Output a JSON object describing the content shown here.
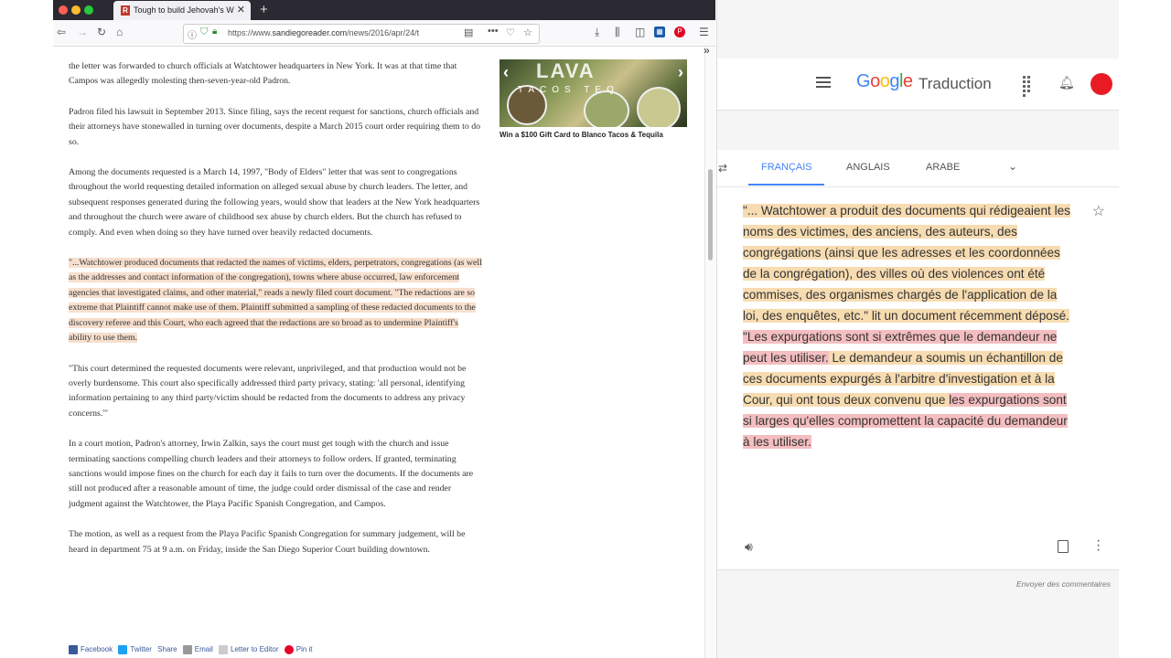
{
  "browser": {
    "tab_title": "Tough to build Jehovah's Witne",
    "tab_favicon": "R",
    "url_prefix": "https://www.",
    "url_domain": "sandiegoreader.com",
    "url_path": "/news/2016/apr/24/t",
    "icons": [
      "back-icon",
      "forward-icon",
      "reload-icon",
      "home-icon",
      "info-icon",
      "shield-icon",
      "lock-icon",
      "reader-icon",
      "more-icon",
      "pocket-icon",
      "bookmark-star-icon",
      "download-icon",
      "library-icon",
      "sidebar-icon",
      "extension-icon",
      "pinterest-icon",
      "menu-icon"
    ]
  },
  "article": {
    "paragraphs": [
      "the letter was forwarded to church officials at Watchtower headquarters in New York. It was at that time that Campos was allegedly molesting then-seven-year-old Padron.",
      "Padron filed his lawsuit in September 2013. Since filing, says the recent request for sanctions, church officials and their attorneys have stonewalled in turning over documents, despite a March 2015 court order requiring them to do so.",
      "Among the documents requested is a March 14, 1997, \"Body of Elders\" letter that was sent to congregations throughout the world requesting detailed information on alleged sexual abuse by church leaders. The letter, and subsequent responses generated during the following years, would show that leaders at the New York headquarters and throughout the church were aware of childhood sex abuse by church elders. But the church has refused to comply. And even when doing so they have turned over heavily redacted documents.",
      "\"...Watchtower produced documents that redacted the names of victims, elders, perpetrators, congregations (as well as the addresses and contact information of the congregation), towns where abuse occurred, law enforcement agencies that investigated claims, and other material,\" reads a newly filed court document. \"The redactions are so extreme that Plaintiff cannot make use of them. Plaintiff submitted a sampling of these redacted documents to the discovery referee and this Court, who each agreed that the redactions are so broad as to undermine Plaintiff's ability to use them.",
      "\"This court determined the requested documents were relevant, unprivileged, and that production would not be overly burdensome. This court also specifically addressed third party privacy, stating: 'all personal, identifying information pertaining to any third party/victim should be redacted from the documents to address any privacy concerns.'\"",
      "In a court motion, Padron's attorney, Irwin Zalkin, says the court must get tough with the church and issue terminating sanctions compelling church leaders and their attorneys to follow orders. If granted, terminating sanctions would impose fines on the church for each day it fails to turn over the documents. If the documents are still not produced after a reasonable amount of time, the judge could order dismissal of the case and render judgment against the Watchtower, the Playa Pacific Spanish Congregation, and Campos.",
      "The motion, as well as a request from the Playa Pacific Spanish Congregation for summary judgement, will be heard in department 75 at 9 a.m. on Friday, inside the San Diego Superior Court building downtown."
    ],
    "share": {
      "facebook": "Facebook",
      "twitter": "Twitter",
      "share": "Share",
      "email": "Email",
      "letter": "Letter to Editor",
      "pin": "Pin it"
    }
  },
  "ad": {
    "banner_text": "LAVA",
    "banner_sub": "TACOS TEQ",
    "caption": "Win a $100 Gift Card to Blanco Tacos & Tequila"
  },
  "translate": {
    "logo": "Google",
    "title": "Traduction",
    "languages": [
      "FRANÇAIS",
      "ANGLAIS",
      "ARABE"
    ],
    "active_language": "FRANÇAIS",
    "segments": [
      {
        "text": "\"... Watchtower a produit des documents qui rédigeaient les noms des victimes, des anciens, des auteurs, des congrégations (ainsi que les adresses et les coordonnées de la congrégation), des villes où des violences ont été commises, des organismes chargés de l'application de la loi, des enquêtes, etc.\" lit un document récemment déposé.",
        "highlight": "yellow"
      },
      {
        "text": " \"Les expurgations sont si extrêmes que le demandeur ne peut les utiliser.",
        "highlight": "pink"
      },
      {
        "text": " Le demandeur a soumis un échantillon de ces documents expurgés à l'arbitre d'investigation et à la Cour, qui ont tous deux convenu que ",
        "highlight": "yellow"
      },
      {
        "text": "les expurgations sont si larges qu'elles compromettent la capacité du demandeur à les utiliser.",
        "highlight": "pink"
      }
    ],
    "feedback": "Envoyer des commentaires",
    "colors": {
      "accent": "#4285f4",
      "yellow_highlight": "#f7dcb1",
      "pink_highlight": "#f4bec0",
      "avatar": "#e81b23"
    }
  }
}
